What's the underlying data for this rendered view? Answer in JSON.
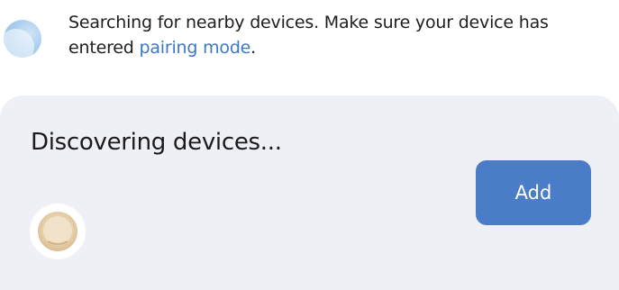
{
  "status": {
    "message_prefix": "Searching for nearby devices. Make sure your device has entered ",
    "link_text": "pairing mode",
    "message_suffix": "."
  },
  "discovery": {
    "title": "Discovering devices...",
    "add_label": "Add"
  },
  "icons": {
    "scan": "scanning-indicator-icon",
    "device": "device-thumbnail-icon"
  },
  "colors": {
    "accent": "#4a7cc7",
    "link": "#3d78c8",
    "card_bg": "#eff0f6"
  }
}
